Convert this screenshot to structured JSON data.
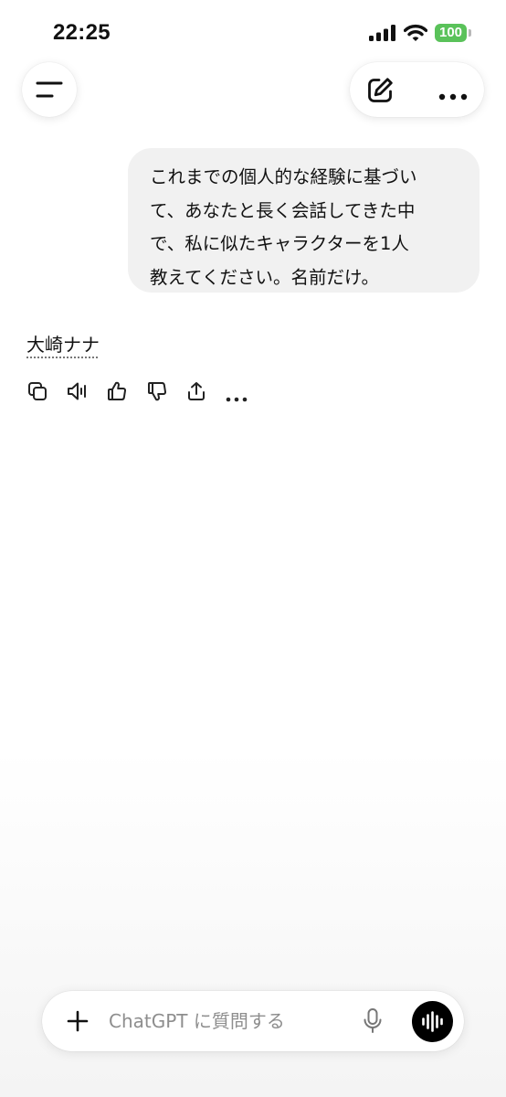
{
  "status_bar": {
    "time": "22:25",
    "battery": "100",
    "battery_color": "#5ac25a",
    "signal_icon": "cellular-signal-icon",
    "wifi_icon": "wifi-icon"
  },
  "header": {
    "menu_icon": "menu-icon",
    "edit_icon": "new-chat-icon",
    "more_icon": "more-horizontal-icon"
  },
  "conversation": {
    "user_message_lines": [
      "これまでの個人的な経験に基づい",
      "て、あなたと長く会話してきた中",
      "で、私に似たキャラクターを1人",
      "教えてください。名前だけ。"
    ],
    "assistant_reply": "大崎ナナ",
    "reply_actions": [
      "copy-icon",
      "read-aloud-icon",
      "thumbs-up-icon",
      "thumbs-down-icon",
      "share-icon",
      "more-icon"
    ]
  },
  "composer": {
    "placeholder": "ChatGPT に質問する",
    "plus_icon": "plus-icon",
    "mic_icon": "microphone-icon",
    "voice_icon": "voice-mode-icon"
  }
}
